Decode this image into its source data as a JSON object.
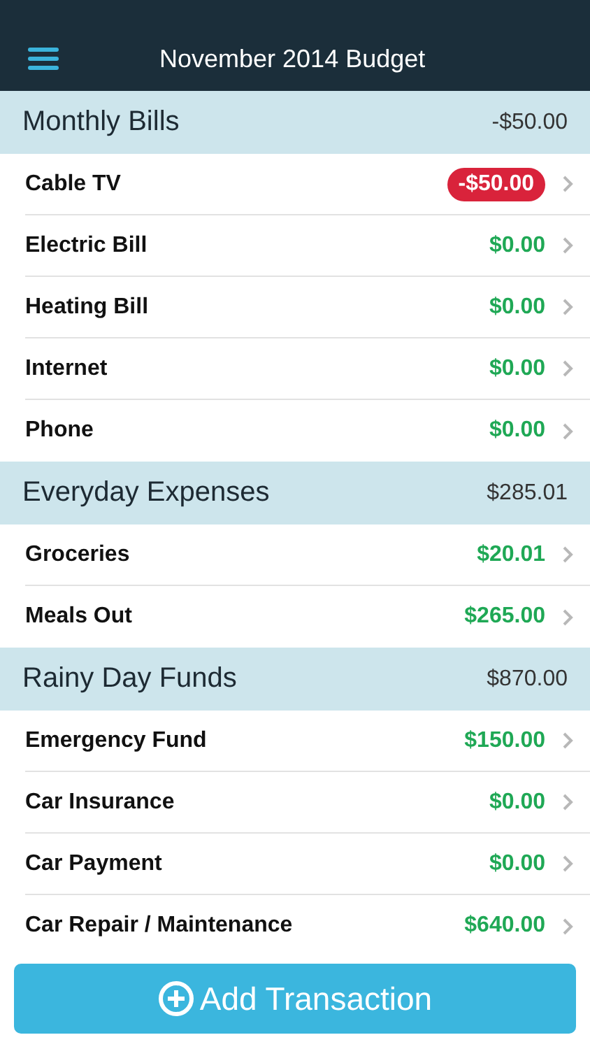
{
  "header": {
    "title": "November 2014 Budget"
  },
  "sections": [
    {
      "name": "Monthly Bills",
      "total": "-$50.00",
      "items": [
        {
          "name": "Cable TV",
          "amount": "-$50.00",
          "negative": true
        },
        {
          "name": "Electric Bill",
          "amount": "$0.00",
          "negative": false
        },
        {
          "name": "Heating Bill",
          "amount": "$0.00",
          "negative": false
        },
        {
          "name": "Internet",
          "amount": "$0.00",
          "negative": false
        },
        {
          "name": "Phone",
          "amount": "$0.00",
          "negative": false
        }
      ]
    },
    {
      "name": "Everyday Expenses",
      "total": "$285.01",
      "items": [
        {
          "name": "Groceries",
          "amount": "$20.01",
          "negative": false
        },
        {
          "name": "Meals Out",
          "amount": "$265.00",
          "negative": false
        }
      ]
    },
    {
      "name": "Rainy Day Funds",
      "total": "$870.00",
      "items": [
        {
          "name": "Emergency Fund",
          "amount": "$150.00",
          "negative": false
        },
        {
          "name": "Car Insurance",
          "amount": "$0.00",
          "negative": false
        },
        {
          "name": "Car Payment",
          "amount": "$0.00",
          "negative": false
        },
        {
          "name": "Car Repair / Maintenance",
          "amount": "$640.00",
          "negative": false
        }
      ]
    }
  ],
  "add_button": {
    "label": "Add Transaction"
  }
}
